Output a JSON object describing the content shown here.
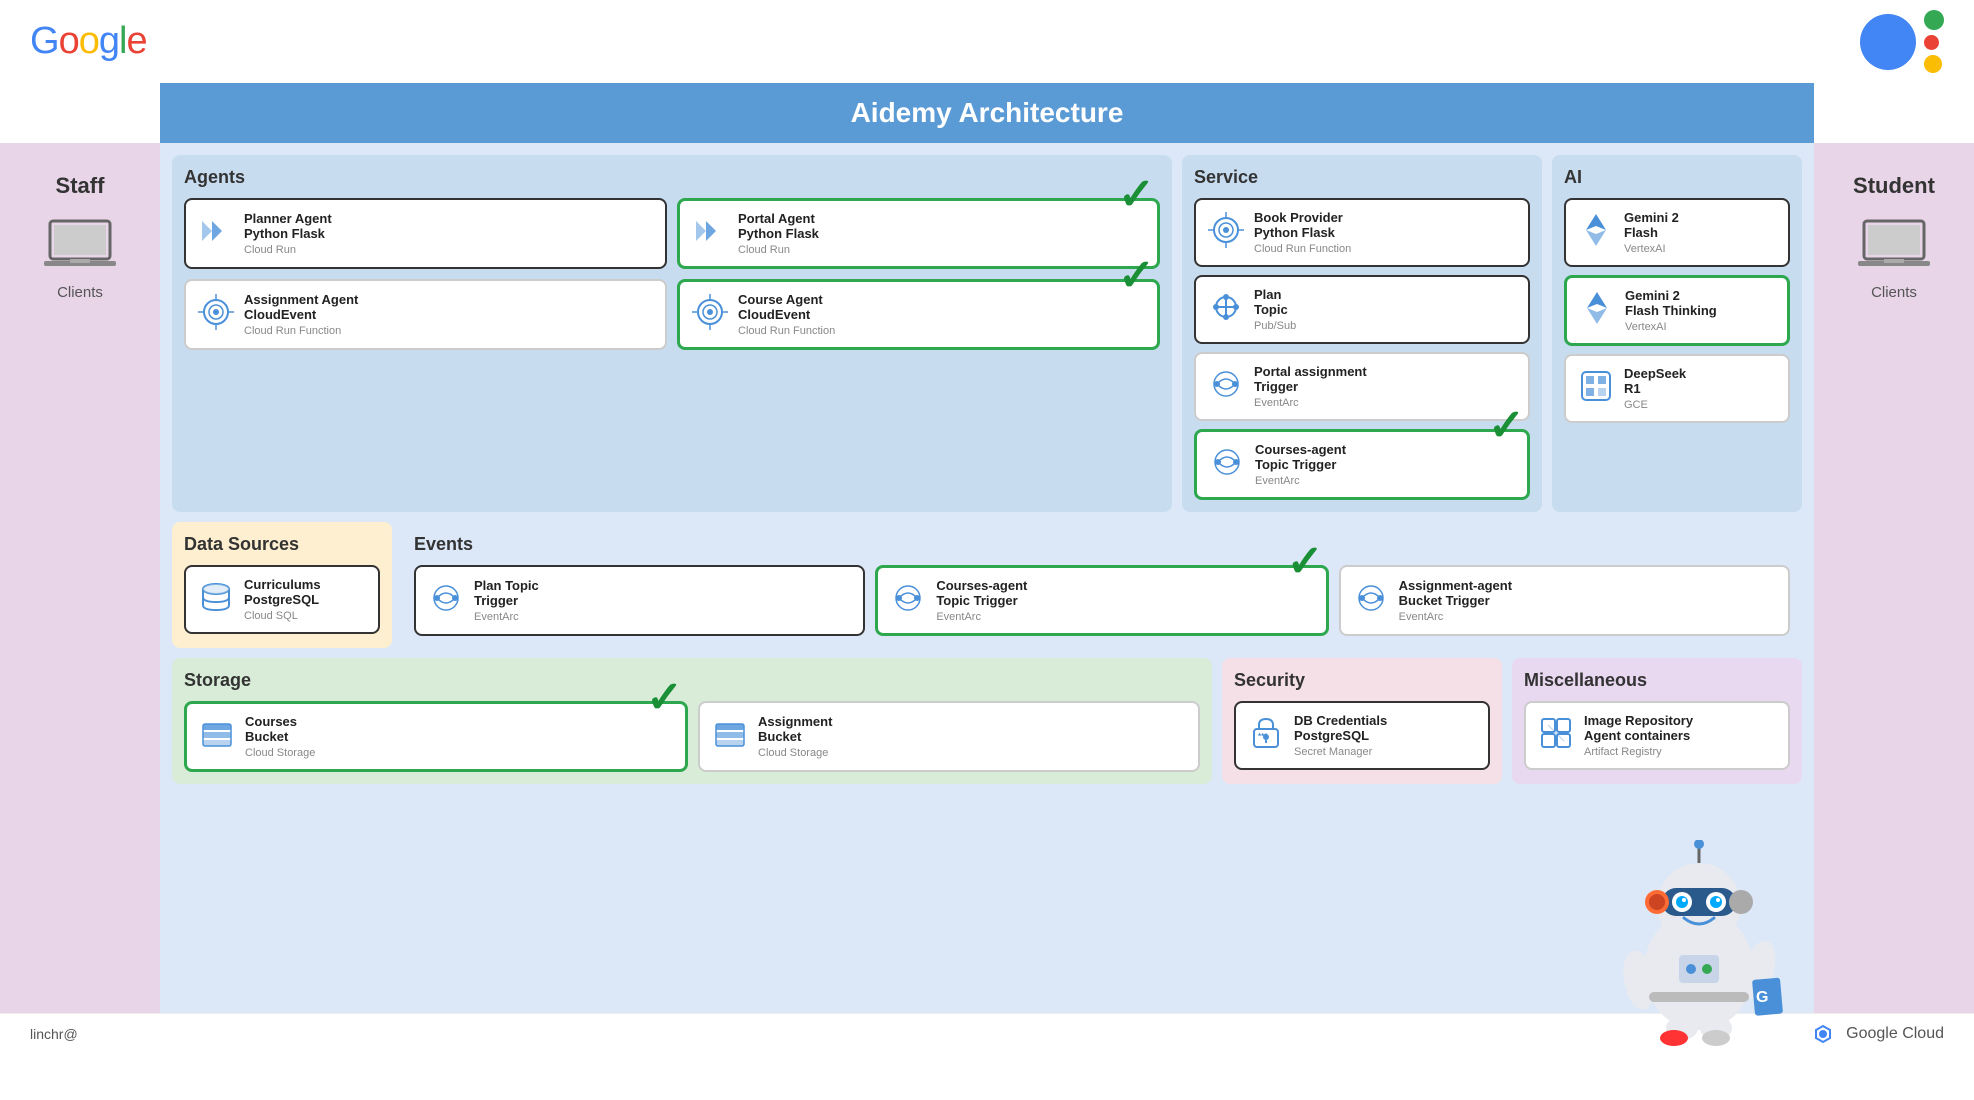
{
  "header": {
    "google_logo": "Google",
    "title": "Aidemy Architecture"
  },
  "sidebar_left": {
    "label": "Staff",
    "client_label": "Clients"
  },
  "sidebar_right": {
    "label": "Student",
    "client_label": "Clients"
  },
  "agents": {
    "section_title": "Agents",
    "cards": [
      {
        "id": "planner-agent",
        "title": "Planner Agent\nPython Flask",
        "subtitle": "Cloud Run",
        "highlighted": false,
        "dark_border": true,
        "checkmark": false,
        "icon": "chevron-double-right"
      },
      {
        "id": "portal-agent",
        "title": "Portal Agent\nPython Flask",
        "subtitle": "Cloud Run",
        "highlighted": true,
        "dark_border": false,
        "checkmark": true,
        "icon": "chevron-double-right"
      },
      {
        "id": "assignment-agent",
        "title": "Assignment Agent\nCloudEvent",
        "subtitle": "Cloud Run Function",
        "highlighted": false,
        "dark_border": false,
        "checkmark": false,
        "icon": "event-circles"
      },
      {
        "id": "course-agent",
        "title": "Course Agent\nCloudEvent",
        "subtitle": "Cloud Run Function",
        "highlighted": true,
        "dark_border": false,
        "checkmark": true,
        "icon": "event-circles"
      }
    ]
  },
  "service": {
    "section_title": "Service",
    "cards": [
      {
        "id": "book-provider",
        "title": "Book Provider\nPython Flask",
        "subtitle": "Cloud Run Function",
        "highlighted": false,
        "dark_border": true,
        "checkmark": false,
        "icon": "event-circles"
      },
      {
        "id": "plan-topic",
        "title": "Plan\nTopic",
        "subtitle": "Pub/Sub",
        "highlighted": false,
        "dark_border": true,
        "checkmark": false,
        "icon": "pubsub"
      },
      {
        "id": "portal-assignment-trigger",
        "title": "Portal assignment\nTrigger",
        "subtitle": "EventArc",
        "highlighted": false,
        "dark_border": false,
        "checkmark": false,
        "icon": "eventarc"
      },
      {
        "id": "courses-agent-topic",
        "title": "Courses-agent\nTopic Trigger",
        "subtitle": "EventArc",
        "highlighted": true,
        "dark_border": false,
        "checkmark": true,
        "icon": "eventarc"
      }
    ]
  },
  "ai": {
    "section_title": "AI",
    "cards": [
      {
        "id": "gemini-flash",
        "title": "Gemini 2\nFlash",
        "subtitle": "VertexAI",
        "highlighted": false,
        "dark_border": true,
        "icon": "gemini"
      },
      {
        "id": "gemini-flash-thinking",
        "title": "Gemini 2\nFlash Thinking",
        "subtitle": "VertexAI",
        "highlighted": true,
        "dark_border": false,
        "icon": "gemini"
      },
      {
        "id": "deepseek-r1",
        "title": "DeepSeek\nR1",
        "subtitle": "GCE",
        "highlighted": false,
        "dark_border": false,
        "icon": "deepseek"
      }
    ]
  },
  "data_sources": {
    "section_title": "Data Sources",
    "cards": [
      {
        "id": "curriculums-postgresql",
        "title": "Curriculums\nPostgreSQL",
        "subtitle": "Cloud SQL",
        "highlighted": false,
        "dark_border": true,
        "icon": "cloud-sql"
      }
    ]
  },
  "events": {
    "section_title": "Events",
    "cards": [
      {
        "id": "plan-topic-trigger",
        "title": "Plan Topic\nTrigger",
        "subtitle": "EventArc",
        "highlighted": false,
        "dark_border": true,
        "checkmark": false,
        "icon": "eventarc"
      },
      {
        "id": "courses-agent-topic-trigger",
        "title": "Courses-agent\nTopic Trigger",
        "subtitle": "EventArc",
        "highlighted": true,
        "dark_border": false,
        "checkmark": true,
        "icon": "eventarc"
      },
      {
        "id": "assignment-agent-bucket",
        "title": "Assignment-agent\nBucket Trigger",
        "subtitle": "EventArc",
        "highlighted": false,
        "dark_border": false,
        "checkmark": false,
        "icon": "eventarc"
      }
    ]
  },
  "storage": {
    "section_title": "Storage",
    "cards": [
      {
        "id": "courses-bucket",
        "title": "Courses\nBucket",
        "subtitle": "Cloud Storage",
        "highlighted": true,
        "dark_border": false,
        "checkmark": true,
        "icon": "storage"
      },
      {
        "id": "assignment-bucket",
        "title": "Assignment\nBucket",
        "subtitle": "Cloud Storage",
        "highlighted": false,
        "dark_border": false,
        "checkmark": false,
        "icon": "storage"
      }
    ]
  },
  "security": {
    "section_title": "Security",
    "cards": [
      {
        "id": "db-credentials",
        "title": "DB Credentials\nPostgreSQL",
        "subtitle": "Secret Manager",
        "highlighted": false,
        "dark_border": true,
        "icon": "secret-manager"
      }
    ]
  },
  "miscellaneous": {
    "section_title": "Miscellaneous",
    "cards": [
      {
        "id": "image-repository",
        "title": "Image Repository\nAgent containers",
        "subtitle": "Artifact Registry",
        "highlighted": false,
        "dark_border": false,
        "icon": "artifact-registry"
      }
    ]
  },
  "footer": {
    "user": "linchr@",
    "google_cloud": "Google Cloud"
  },
  "colors": {
    "green_check": "#1a8f36",
    "highlight_border": "#2ea84e",
    "dark_border": "#333333",
    "card_bg": "#ffffff",
    "agents_bg": "#c8dcf0",
    "service_bg": "#c8dcf0",
    "ai_bg": "#c8dcf0",
    "datasources_bg": "#fdefd0",
    "events_bg": "#dce8f7",
    "storage_bg": "#d8ecd8",
    "security_bg": "#f5e0e8",
    "misc_bg": "#e8d8f0",
    "diagram_bg": "#dce8f7",
    "sidebar_bg": "#e8d5e8",
    "title_bg": "#5B9BD5"
  }
}
